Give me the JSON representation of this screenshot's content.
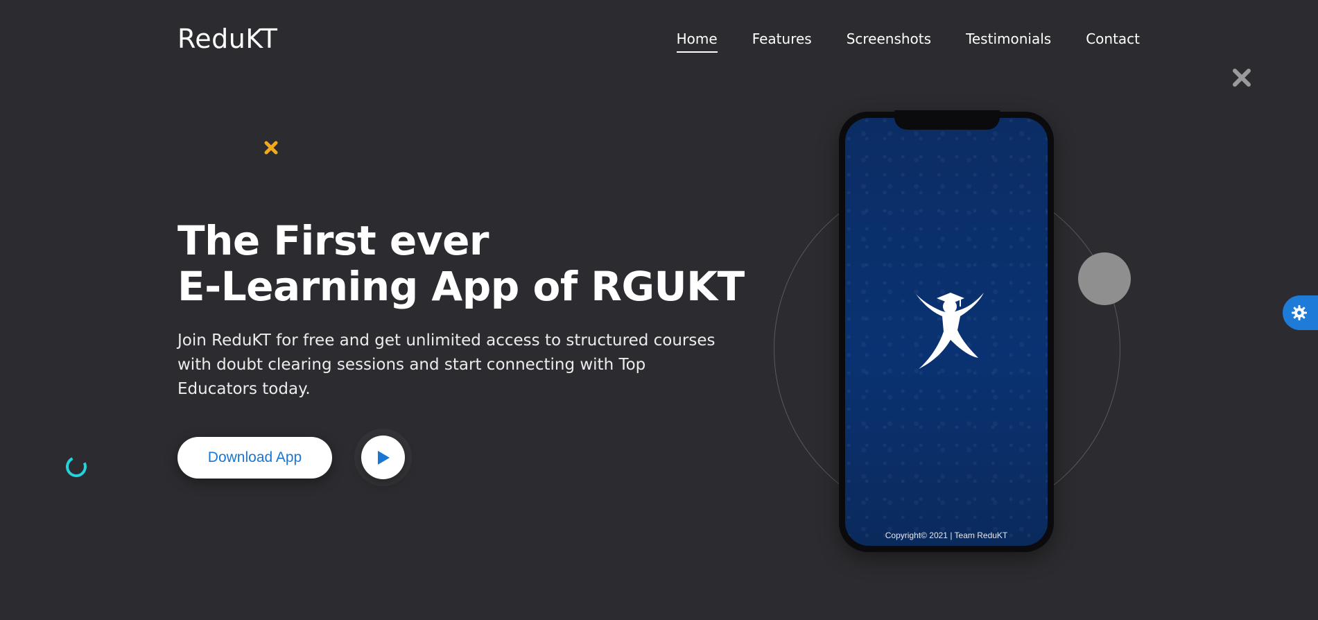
{
  "brand": {
    "name": "ReduKT"
  },
  "nav": {
    "items": [
      {
        "label": "Home",
        "active": true
      },
      {
        "label": "Features"
      },
      {
        "label": "Screenshots"
      },
      {
        "label": "Testimonials"
      },
      {
        "label": "Contact"
      }
    ]
  },
  "hero": {
    "title_line1": "The First ever",
    "title_line2": "E-Learning App of RGUKT",
    "description": "Join ReduKT for free and get unlimited access to structured courses with doubt clearing sessions and start connecting with Top Educators today.",
    "download_label": "Download App",
    "play_icon": "play-icon"
  },
  "phone": {
    "copyright": "Copyright© 2021 | Team ReduKT",
    "logo_icon": "graduate-figure-icon"
  },
  "icons": {
    "close": "close-icon",
    "settings": "gear-icon",
    "decor_cross": "cross-icon",
    "decor_ring": "ring-icon"
  },
  "colors": {
    "background": "#2c2c30",
    "accent": "#1976d2",
    "phone_screen": "#0a3272",
    "decor_cross": "#f2a91b",
    "decor_ring": "#24d3dc",
    "settings_tab": "#1f7bd8"
  }
}
